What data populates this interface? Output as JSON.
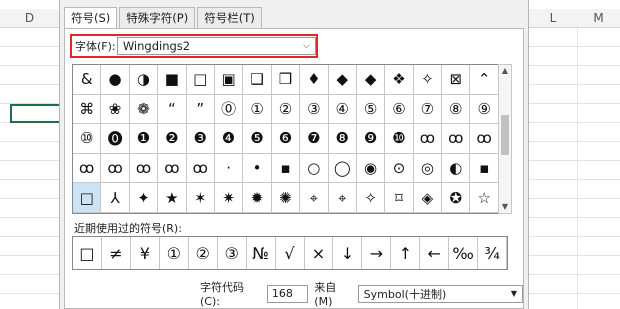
{
  "sheet": {
    "columns": [
      "D",
      "L",
      "M"
    ]
  },
  "tabs": [
    {
      "label": "符号(S)"
    },
    {
      "label": "特殊字符(P)"
    },
    {
      "label": "符号栏(T)"
    }
  ],
  "font": {
    "label": "字体(F):",
    "value": "Wingdings2"
  },
  "symbols": [
    "&",
    "●",
    "◑",
    "■",
    "□",
    "▣",
    "❑",
    "❒",
    "♦",
    "◆",
    "◆",
    "❖",
    "✧",
    "⊠",
    "⌃",
    "⌘",
    "❀",
    "❁",
    "“",
    "”",
    "⓪",
    "①",
    "②",
    "③",
    "④",
    "⑤",
    "⑥",
    "⑦",
    "⑧",
    "⑨",
    "⑩",
    "⓿",
    "❶",
    "❷",
    "❸",
    "❹",
    "❺",
    "❻",
    "❼",
    "❽",
    "❾",
    "❿",
    "ꝏ",
    "ꝏ",
    "ꝏ",
    "ꝏ",
    "ꝏ",
    "ꝏ",
    "ꝏ",
    "ꝏ",
    "·",
    "•",
    "▪",
    "○",
    "◯",
    "◉",
    "⊙",
    "◎",
    "◐",
    "▪",
    "□",
    "⅄",
    "✦",
    "★",
    "✶",
    "✷",
    "✹",
    "✺",
    "⌖",
    "⌖",
    "✧",
    "⌑",
    "◈",
    "✪",
    "☆"
  ],
  "selected_index": 60,
  "recent_label": "近期使用过的符号(R):",
  "recent": [
    "□",
    "≠",
    "¥",
    "①",
    "②",
    "③",
    "№",
    "√",
    "×",
    "↓",
    "→",
    "↑",
    "←",
    "‰",
    "¾"
  ],
  "bottom": {
    "code_label": "字符代码(C):",
    "code_value": "168",
    "from_label": "来自(M)",
    "from_value": "Symbol(十进制)"
  }
}
